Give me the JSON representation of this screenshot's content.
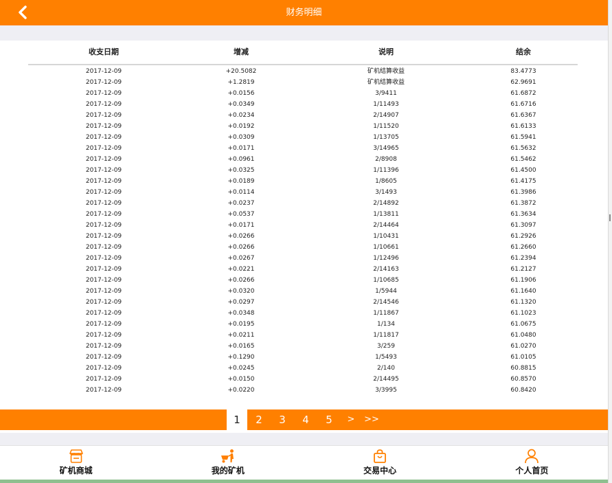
{
  "header": {
    "title": "财务明细",
    "back_icon": "chevron-left-icon"
  },
  "table": {
    "columns": [
      "收支日期",
      "增减",
      "说明",
      "结余"
    ],
    "rows": [
      [
        "2017-12-09",
        "+20.5082",
        "矿机结算收益",
        "83.4773"
      ],
      [
        "2017-12-09",
        "+1.2819",
        "矿机结算收益",
        "62.9691"
      ],
      [
        "2017-12-09",
        "+0.0156",
        "3/9411",
        "61.6872"
      ],
      [
        "2017-12-09",
        "+0.0349",
        "1/11493",
        "61.6716"
      ],
      [
        "2017-12-09",
        "+0.0234",
        "2/14907",
        "61.6367"
      ],
      [
        "2017-12-09",
        "+0.0192",
        "1/11520",
        "61.6133"
      ],
      [
        "2017-12-09",
        "+0.0309",
        "1/13705",
        "61.5941"
      ],
      [
        "2017-12-09",
        "+0.0171",
        "3/14965",
        "61.5632"
      ],
      [
        "2017-12-09",
        "+0.0961",
        "2/8908",
        "61.5462"
      ],
      [
        "2017-12-09",
        "+0.0325",
        "1/11396",
        "61.4500"
      ],
      [
        "2017-12-09",
        "+0.0189",
        "1/8605",
        "61.4175"
      ],
      [
        "2017-12-09",
        "+0.0114",
        "3/1493",
        "61.3986"
      ],
      [
        "2017-12-09",
        "+0.0237",
        "2/14892",
        "61.3872"
      ],
      [
        "2017-12-09",
        "+0.0537",
        "1/13811",
        "61.3634"
      ],
      [
        "2017-12-09",
        "+0.0171",
        "2/14464",
        "61.3097"
      ],
      [
        "2017-12-09",
        "+0.0266",
        "1/10431",
        "61.2926"
      ],
      [
        "2017-12-09",
        "+0.0266",
        "1/10661",
        "61.2660"
      ],
      [
        "2017-12-09",
        "+0.0267",
        "1/12496",
        "61.2394"
      ],
      [
        "2017-12-09",
        "+0.0221",
        "2/14163",
        "61.2127"
      ],
      [
        "2017-12-09",
        "+0.0266",
        "1/10685",
        "61.1906"
      ],
      [
        "2017-12-09",
        "+0.0320",
        "1/5944",
        "61.1640"
      ],
      [
        "2017-12-09",
        "+0.0297",
        "2/14546",
        "61.1320"
      ],
      [
        "2017-12-09",
        "+0.0348",
        "1/11867",
        "61.1023"
      ],
      [
        "2017-12-09",
        "+0.0195",
        "1/134",
        "61.0675"
      ],
      [
        "2017-12-09",
        "+0.0211",
        "1/11817",
        "61.0480"
      ],
      [
        "2017-12-09",
        "+0.0165",
        "3/259",
        "61.0270"
      ],
      [
        "2017-12-09",
        "+0.1290",
        "1/5493",
        "61.0105"
      ],
      [
        "2017-12-09",
        "+0.0245",
        "2/140",
        "60.8815"
      ],
      [
        "2017-12-09",
        "+0.0150",
        "2/14495",
        "60.8570"
      ],
      [
        "2017-12-09",
        "+0.0220",
        "3/3995",
        "60.8420"
      ]
    ]
  },
  "pagination": {
    "current": "1",
    "pages": [
      "2",
      "3",
      "4",
      "5"
    ],
    "next_label": ">",
    "last_label": ">>"
  },
  "tabbar": {
    "items": [
      {
        "label": "矿机商城",
        "icon": "store-icon"
      },
      {
        "label": "我的矿机",
        "icon": "miner-icon"
      },
      {
        "label": "交易中心",
        "icon": "shopping-bag-icon"
      },
      {
        "label": "个人首页",
        "icon": "user-icon"
      }
    ]
  },
  "colors": {
    "accent": "#ff8000",
    "background_gap": "#efeff4"
  }
}
